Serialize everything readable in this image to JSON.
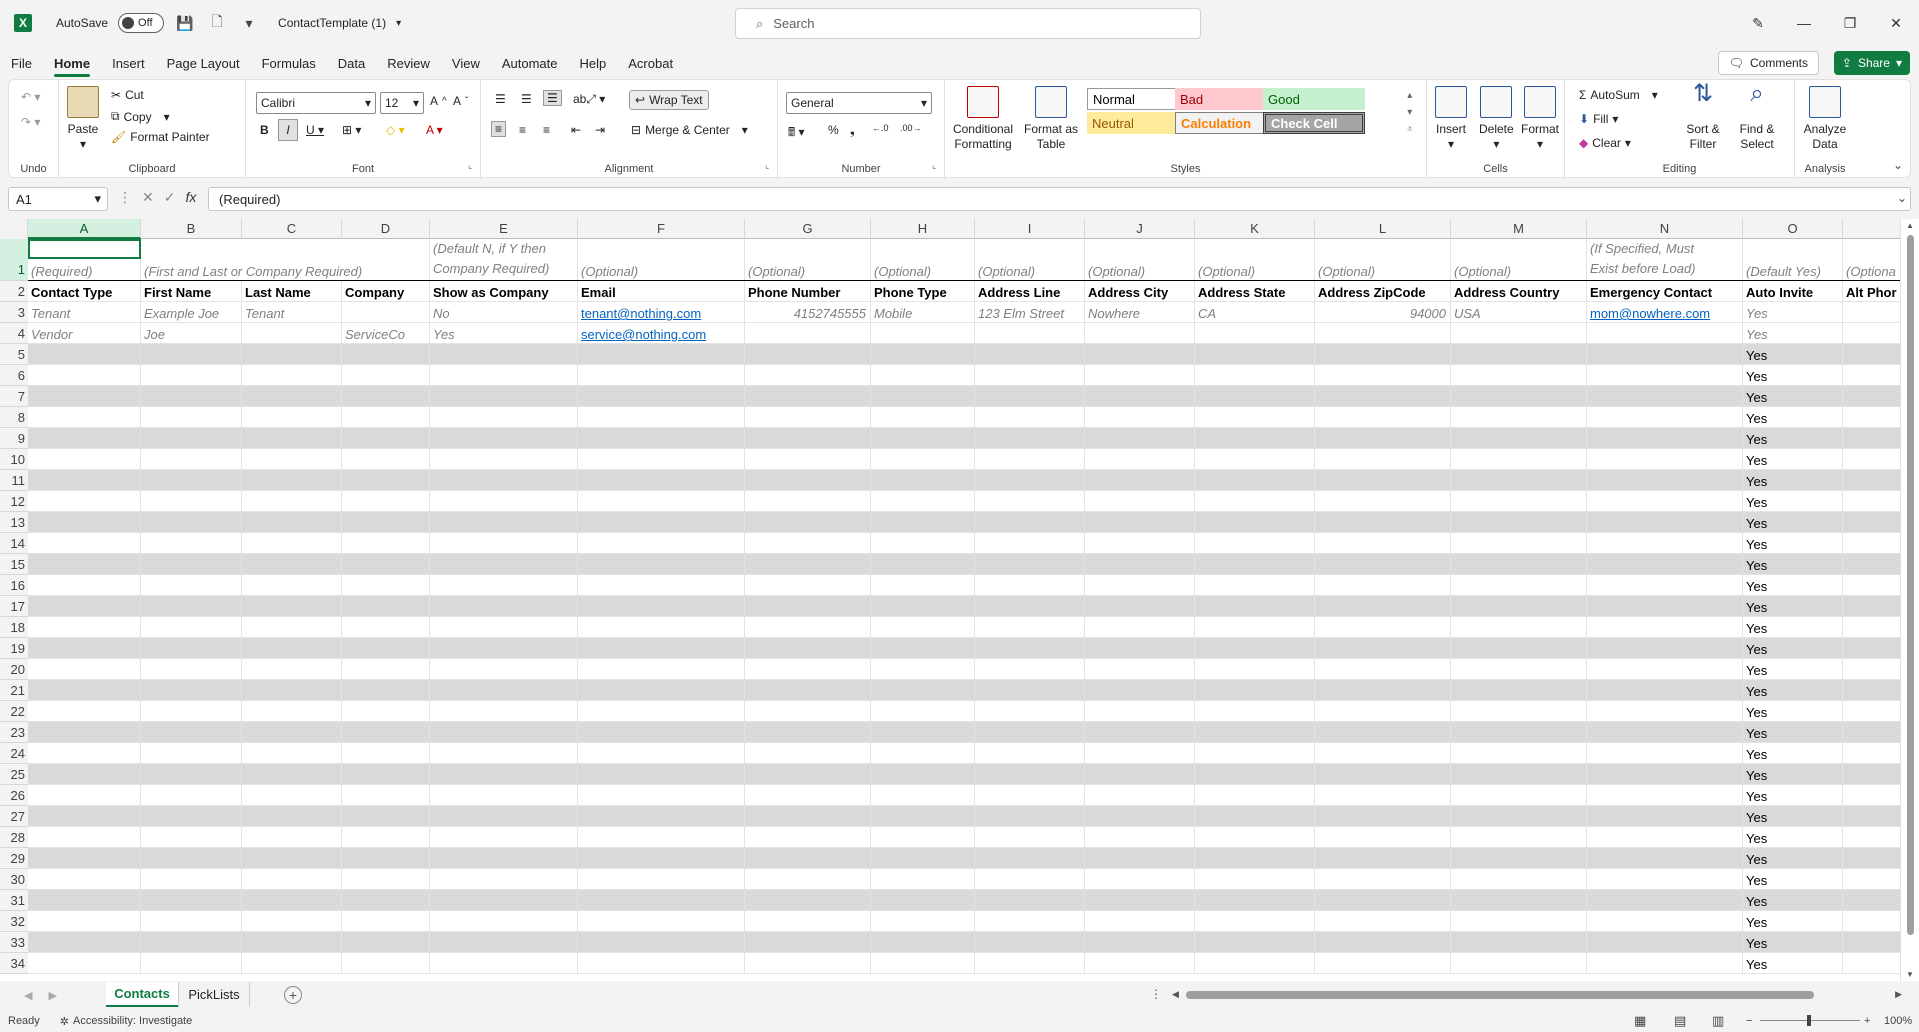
{
  "titlebar": {
    "app_icon_letter": "X",
    "autosave_label": "AutoSave",
    "autosave_state": "Off",
    "file_name": "ContactTemplate (1)",
    "search_placeholder": "Search"
  },
  "menu": [
    "File",
    "Home",
    "Insert",
    "Page Layout",
    "Formulas",
    "Data",
    "Review",
    "View",
    "Automate",
    "Help",
    "Acrobat"
  ],
  "menu_active": "Home",
  "comments_label": "Comments",
  "share_label": "Share",
  "ribbon": {
    "undo_group": "Undo",
    "clipboard": {
      "paste": "Paste",
      "cut": "Cut",
      "copy": "Copy",
      "format_painter": "Format Painter",
      "label": "Clipboard"
    },
    "font": {
      "name": "Calibri",
      "size": "12",
      "label": "Font"
    },
    "alignment": {
      "wrap_text": "Wrap Text",
      "merge_center": "Merge & Center",
      "label": "Alignment"
    },
    "number": {
      "format": "General",
      "label": "Number"
    },
    "styles": {
      "conditional": "Conditional Formatting",
      "format_table": "Format as Table",
      "cells": [
        {
          "name": "Normal",
          "bg": "#ffffff",
          "fg": "#000000"
        },
        {
          "name": "Bad",
          "bg": "#ffc7ce",
          "fg": "#9c0006"
        },
        {
          "name": "Good",
          "bg": "#c6efce",
          "fg": "#006100"
        },
        {
          "name": "Neutral",
          "bg": "#ffeb9c",
          "fg": "#9c5700"
        },
        {
          "name": "Calculation",
          "bg": "#f2f2f2",
          "fg": "#fa7d00"
        },
        {
          "name": "Check Cell",
          "bg": "#a5a5a5",
          "fg": "#ffffff"
        }
      ],
      "label": "Styles"
    },
    "cells": {
      "insert": "Insert",
      "delete": "Delete",
      "format": "Format",
      "label": "Cells"
    },
    "editing": {
      "autosum": "AutoSum",
      "fill": "Fill",
      "clear": "Clear",
      "sort_filter": "Sort & Filter",
      "find_select": "Find & Select",
      "label": "Editing"
    },
    "analysis": {
      "analyze": "Analyze Data",
      "label": "Analysis"
    }
  },
  "formula_bar": {
    "name_box": "A1",
    "fx": "fx",
    "content": "(Required)"
  },
  "columns": [
    "A",
    "B",
    "C",
    "D",
    "E",
    "F",
    "G",
    "H",
    "I",
    "J",
    "K",
    "L",
    "M",
    "N",
    "O"
  ],
  "row1": {
    "A": "(Required)",
    "B": "(First and Last or Company Required)",
    "E1": "(Default N, if Y then",
    "E2": "Company Required)",
    "F": "(Optional)",
    "G": "(Optional)",
    "H": "(Optional)",
    "I": "(Optional)",
    "J": "(Optional)",
    "K": "(Optional)",
    "L": "(Optional)",
    "M": "(Optional)",
    "N1": "(If Specified, Must",
    "N2": "Exist before Load)",
    "O": "(Default Yes)",
    "P": "(Optiona"
  },
  "headers": [
    "Contact Type",
    "First Name",
    "Last Name",
    "Company",
    "Show as Company",
    "Email",
    "Phone Number",
    "Phone Type",
    "Address Line",
    "Address City",
    "Address State",
    "Address ZipCode",
    "Address Country",
    "Emergency Contact",
    "Auto Invite",
    "Alt Phor"
  ],
  "row3": [
    "Tenant",
    "Example Joe",
    "Tenant",
    "",
    "No",
    "tenant@nothing.com",
    "4152745555",
    "Mobile",
    "123 Elm Street",
    "Nowhere",
    "CA",
    "94000",
    "USA",
    "mom@nowhere.com",
    "Yes"
  ],
  "row4": [
    "Vendor",
    "Joe",
    "",
    "ServiceCo",
    "Yes",
    "service@nothing.com",
    "",
    "",
    "",
    "",
    "",
    "",
    "",
    "",
    "Yes"
  ],
  "default_yes": "Yes",
  "visible_rows": [
    1,
    2,
    3,
    4,
    5,
    6,
    7,
    8,
    9,
    10,
    11,
    12,
    13,
    14,
    15,
    16,
    17,
    18,
    19,
    20,
    21,
    22,
    23,
    24,
    25,
    26,
    27,
    28,
    29,
    30,
    31,
    32,
    33,
    34
  ],
  "sheet_tabs": [
    "Contacts",
    "PickLists"
  ],
  "active_sheet": "Contacts",
  "status": {
    "ready": "Ready",
    "accessibility": "Accessibility: Investigate",
    "zoom": "100%"
  }
}
